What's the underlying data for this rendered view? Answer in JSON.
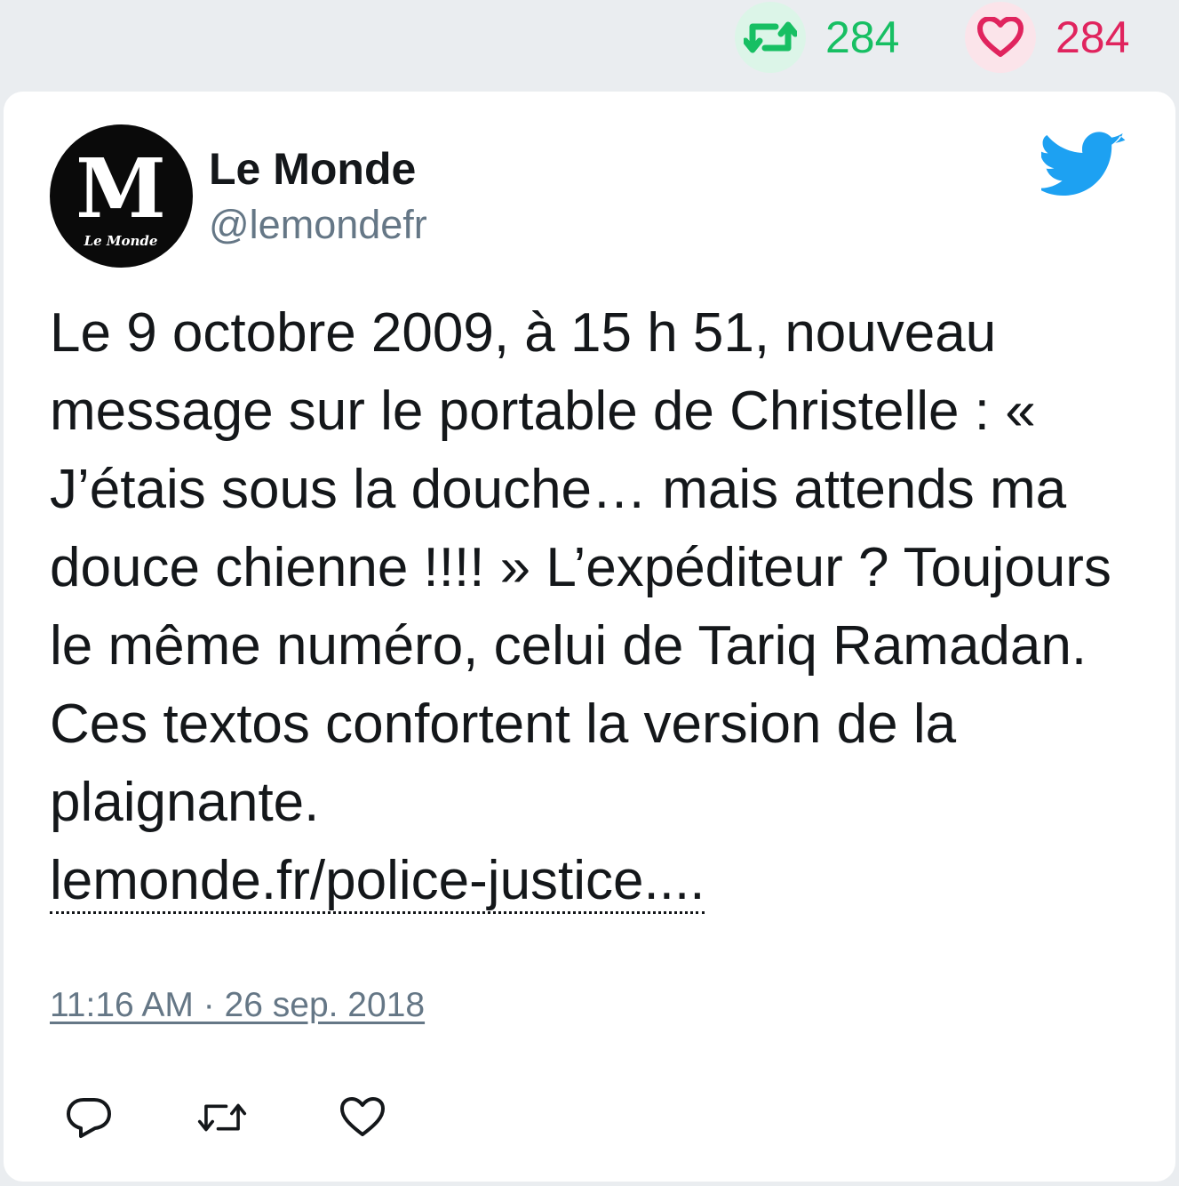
{
  "top_stats": {
    "retweet_count": "284",
    "like_count": "284"
  },
  "tweet": {
    "author_name": "Le Monde",
    "author_handle": "@lemondefr",
    "avatar_alt": "Le Monde",
    "text": "Le 9 octobre 2009, à 15 h 51, nouveau message sur le portable de Christelle : « J’étais sous la douche… mais attends ma douce chienne !!!! » L’expéditeur ? Toujours le même numéro, celui de Tariq Ramadan. Ces textos confortent la version de la plaignante.",
    "link": "lemonde.fr/police-justice....",
    "timestamp": "11:16 AM · 26 sep. 2018"
  },
  "colors": {
    "retweet_green": "#17bf63",
    "like_red": "#e0245e",
    "twitter_blue": "#1da1f2",
    "muted_gray": "#657786"
  },
  "icons": {
    "retweet": "retweet-icon",
    "like": "heart-icon",
    "brand": "twitter-bird-icon",
    "reply": "reply-icon"
  }
}
